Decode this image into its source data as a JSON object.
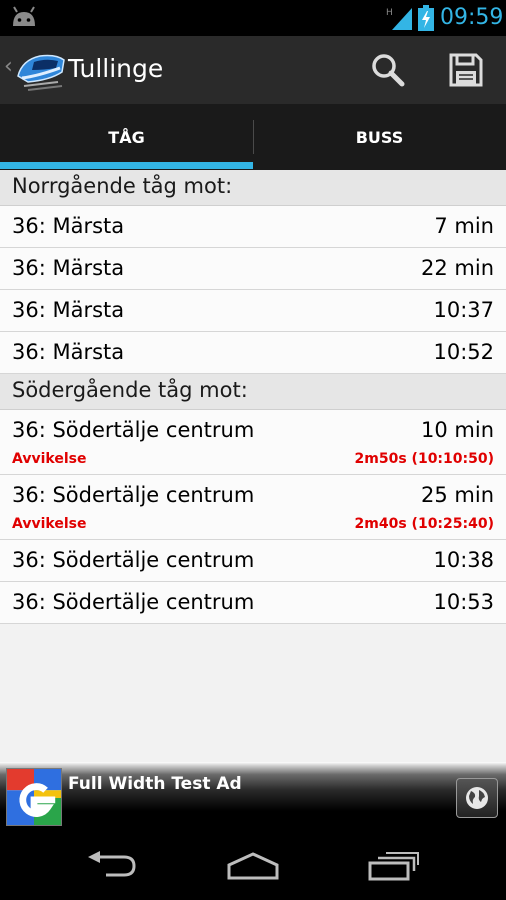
{
  "status_bar": {
    "network": "H",
    "time": "09:59"
  },
  "action_bar": {
    "title": "Tullinge"
  },
  "tabs": [
    {
      "label": "TÅG",
      "selected": true
    },
    {
      "label": "BUSS",
      "selected": false
    }
  ],
  "sections": [
    {
      "header": "Norrgående tåg mot:",
      "rows": [
        {
          "dest": "36: Märsta",
          "time": "7 min"
        },
        {
          "dest": "36: Märsta",
          "time": "22 min"
        },
        {
          "dest": "36: Märsta",
          "time": "10:37"
        },
        {
          "dest": "36: Märsta",
          "time": "10:52"
        }
      ]
    },
    {
      "header": "Södergående tåg mot:",
      "rows": [
        {
          "dest": "36: Södertälje centrum",
          "time": "10 min",
          "deviation_label": "Avvikelse",
          "deviation_value": "2m50s (10:10:50)"
        },
        {
          "dest": "36: Södertälje centrum",
          "time": "25 min",
          "deviation_label": "Avvikelse",
          "deviation_value": "2m40s (10:25:40)"
        },
        {
          "dest": "36: Södertälje centrum",
          "time": "10:38"
        },
        {
          "dest": "36: Södertälje centrum",
          "time": "10:53"
        }
      ]
    }
  ],
  "ad": {
    "text": "Full Width Test Ad"
  },
  "colors": {
    "accent": "#33b5e5",
    "deviation": "#e00000"
  },
  "icons": {
    "status": [
      "android-icon",
      "signal-icon",
      "battery-icon"
    ],
    "action_bar": [
      "train-app-icon",
      "search-icon",
      "save-icon"
    ],
    "ad": [
      "google-logo-icon",
      "globe-icon"
    ],
    "nav": [
      "back-icon",
      "home-icon",
      "recent-apps-icon"
    ]
  }
}
